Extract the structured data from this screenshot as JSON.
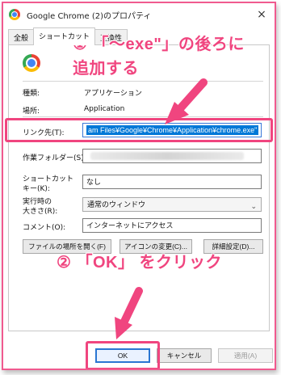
{
  "window": {
    "title": "Google Chrome (2)のプロパティ",
    "close_glyph": "×"
  },
  "tabs": [
    {
      "label": "全般"
    },
    {
      "label": "ショートカット"
    },
    {
      "label": "互換性"
    }
  ],
  "properties": {
    "type_label": "種類:",
    "type_value": "アプリケーション",
    "location_label": "場所:",
    "location_value": "Application",
    "target_label": "リンク先(T):",
    "target_value": "am Files¥Google¥Chrome¥Application¥chrome.exe\"",
    "start_in_label": "作業フォルダー(S):",
    "start_in_value": "",
    "shortcut_key_label_line1": "ショートカット",
    "shortcut_key_label_line2": "キー(K):",
    "shortcut_key_value": "なし",
    "run_label_line1": "実行時の",
    "run_label_line2": "大きさ(R):",
    "run_value": "通常のウィンドウ",
    "comment_label": "コメント(O):",
    "comment_value": "インターネットにアクセス"
  },
  "buttons": {
    "open_location": "ファイルの場所を開く(F)",
    "change_icon": "アイコンの変更(C)...",
    "advanced": "詳細設定(D)...",
    "ok": "OK",
    "cancel": "キャンセル",
    "apply": "適用(A)"
  },
  "annotations": {
    "step1_line1": "① 「～exe\"」の後ろに",
    "step1_line2": "追加する",
    "step2": "② 「OK」 をクリック",
    "accent_color": "#f0457f"
  },
  "icons": {
    "app_icon": "chrome-icon",
    "select_chevron": "chevron-down-icon"
  }
}
